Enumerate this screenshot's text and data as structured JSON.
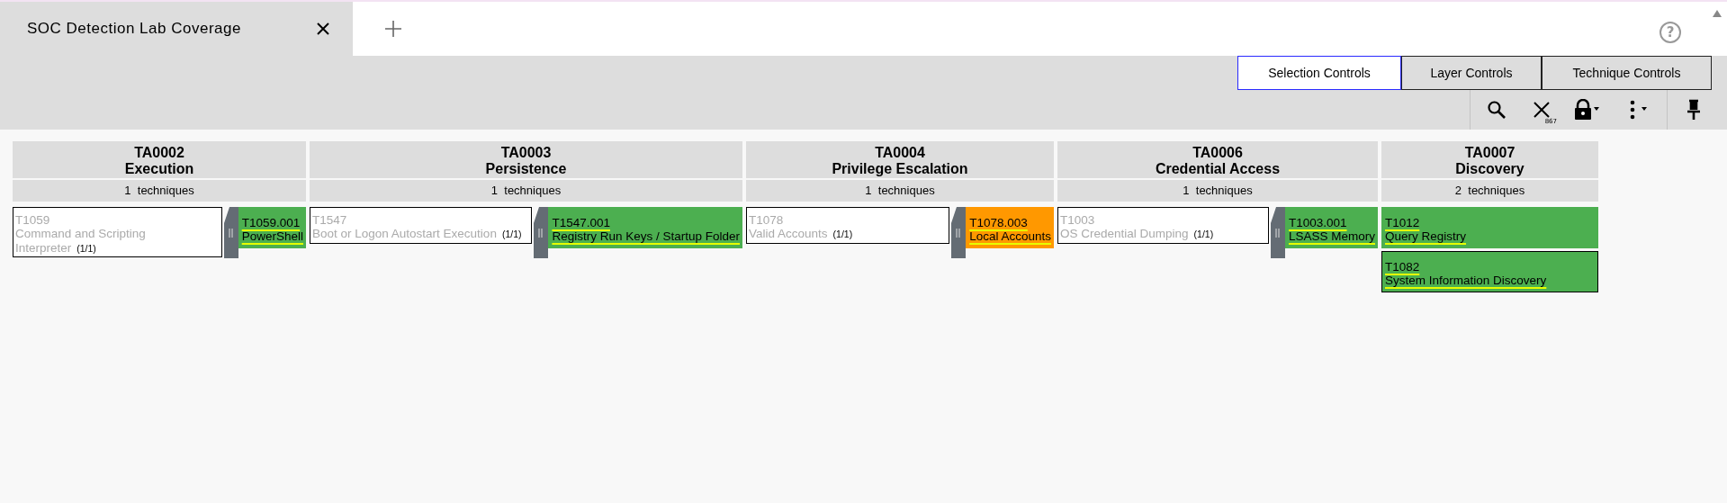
{
  "tabs": [
    {
      "label": "SOC Detection Lab Coverage",
      "selected": true
    }
  ],
  "help": "?",
  "control_tabs": [
    {
      "label": "Selection Controls",
      "selected": true
    },
    {
      "label": "Layer Controls",
      "selected": false
    },
    {
      "label": "Technique Controls",
      "selected": false
    }
  ],
  "toolbar": {
    "deselect_count": "867"
  },
  "tactics": [
    {
      "id": "TA0002",
      "name": "Execution",
      "count": "1  techniques",
      "techniques": [
        {
          "id": "T1059",
          "name": "Command and Scripting Interpreter",
          "score": "(1/1)",
          "subtechniques": [
            {
              "id": "T1059.001",
              "name": "PowerShell",
              "color": "#4caf50",
              "outlined": false
            }
          ]
        }
      ]
    },
    {
      "id": "TA0003",
      "name": "Persistence",
      "count": "1  techniques",
      "techniques": [
        {
          "id": "T1547",
          "name": "Boot or Logon Autostart Execution",
          "score": "(1/1)",
          "subtechniques": [
            {
              "id": "T1547.001",
              "name": "Registry Run Keys / Startup Folder",
              "color": "#4caf50",
              "outlined": false
            }
          ]
        }
      ]
    },
    {
      "id": "TA0004",
      "name": "Privilege Escalation",
      "count": "1  techniques",
      "techniques": [
        {
          "id": "T1078",
          "name": "Valid Accounts",
          "score": "(1/1)",
          "subtechniques": [
            {
              "id": "T1078.003",
              "name": "Local Accounts",
              "color": "#ff9800",
              "outlined": false
            }
          ]
        }
      ]
    },
    {
      "id": "TA0006",
      "name": "Credential Access",
      "count": "1  techniques",
      "techniques": [
        {
          "id": "T1003",
          "name": "OS Credential Dumping",
          "score": "(1/1)",
          "subtechniques": [
            {
              "id": "T1003.001",
              "name": "LSASS Memory",
              "color": "#4caf50",
              "outlined": false
            }
          ]
        }
      ]
    },
    {
      "id": "TA0007",
      "name": "Discovery",
      "count": "2  techniques",
      "techniques": [
        {
          "id": "T1012",
          "name": "Query Registry",
          "color": "#4caf50",
          "outlined": false
        },
        {
          "id": "T1082",
          "name": "System Information Discovery",
          "color": "#4caf50",
          "outlined": true
        }
      ]
    }
  ]
}
